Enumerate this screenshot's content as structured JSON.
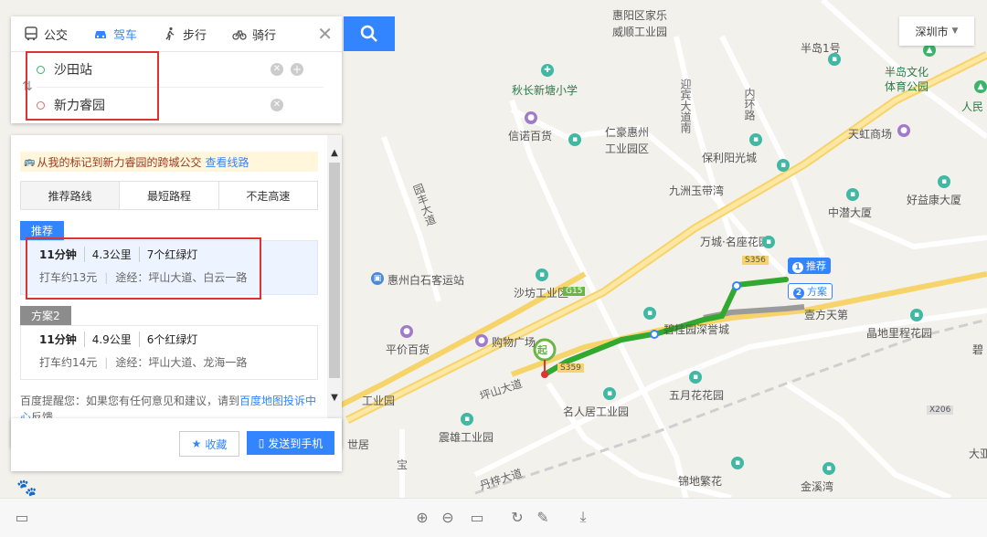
{
  "modes": [
    {
      "label": "公交",
      "icon": "bus-icon"
    },
    {
      "label": "驾车",
      "icon": "car-icon",
      "active": true
    },
    {
      "label": "步行",
      "icon": "walk-icon"
    },
    {
      "label": "骑行",
      "icon": "bike-icon"
    }
  ],
  "route": {
    "origin": "沙田站",
    "destination": "新力睿园"
  },
  "notice": {
    "text": "从我的标记到新力睿园的跨城公交",
    "link": "查看线路"
  },
  "route_tabs": [
    "推荐路线",
    "最短路程",
    "不走高速"
  ],
  "plans": [
    {
      "tag": "推荐",
      "time": "11分钟",
      "distance": "4.3公里",
      "lights": "7个红绿灯",
      "taxi": "打车约13元",
      "via": "途经：坪山大道、白云一路"
    },
    {
      "tag": "方案2",
      "time": "11分钟",
      "distance": "4.9公里",
      "lights": "6个红绿灯",
      "taxi": "打车约14元",
      "via": "途经：坪山大道、龙海一路"
    }
  ],
  "tip": {
    "text": "百度提醒您：如果您有任何意见和建议，请到",
    "link": "百度地图投诉中心",
    "end": "反馈。"
  },
  "actions": {
    "favorite": "收藏",
    "send": "发送到手机"
  },
  "city": "深圳市",
  "map_labels": {
    "huiyang": "惠阳区家乐",
    "weishun": "威顺工业园",
    "bandao1": "半岛1号",
    "bandao_wh": "半岛文化",
    "tiyu": "体育公园",
    "renmin": "人民",
    "qiuchang": "秋长新塘小学",
    "yingbin": "迎宾大道南",
    "neizhou": "内环路",
    "xinnuo": "信诺百货",
    "renhao": "仁豪惠州",
    "gongye": "工业园区",
    "baoli": "保利阳光城",
    "tianhong": "天虹商场",
    "jiuzhou": "九洲玉带湾",
    "zhongshan": "中潜大厦",
    "haoyi": "好益康大厦",
    "road_v": "园丰大道",
    "wancheng": "万城·名座花园",
    "huizhou_bs": "惠州白石客运站",
    "shafang": "沙坊工业区",
    "biguiyuan": "碧桂园深誉城",
    "yifang": "壹方天第",
    "jingdi": "晶地里程花园",
    "bi": "碧",
    "pingjia": "平价百货",
    "gouwu": "购物广场",
    "pingshan": "坪山大道",
    "xgy": "工业园",
    "wuyue": "五月花花园",
    "mingren": "名人居工业园",
    "zhenxiong": "震雄工业园",
    "shiju": "世居",
    "bao": "宝",
    "danzi": "丹梓大道",
    "jindi": "锦地繁花",
    "jinxi": "金溪湾",
    "dazhu": "大亚",
    "s356": "S356",
    "g15": "G15",
    "x206": "X206",
    "s359": "S359"
  },
  "markers": {
    "start": "起",
    "rec": "推荐",
    "alt": "方案",
    "rec_num": "1",
    "alt_num": "2"
  }
}
